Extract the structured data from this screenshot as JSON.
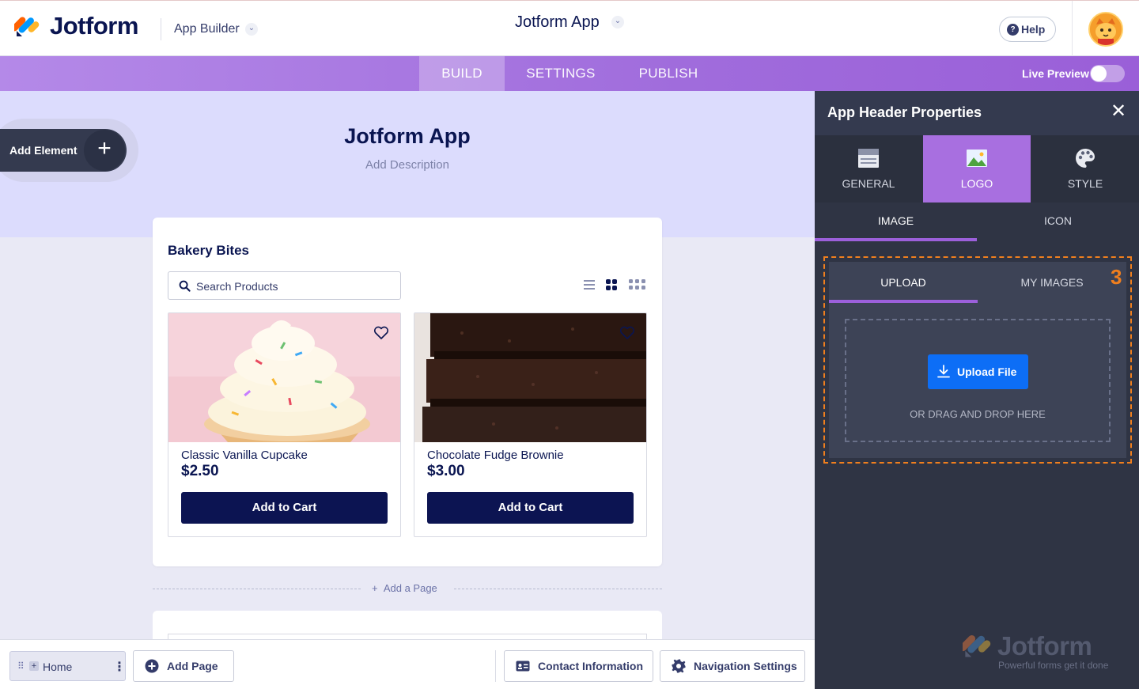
{
  "header": {
    "brand": "Jotform",
    "section": "App Builder",
    "app_title": "Jotform App",
    "help": "Help"
  },
  "tabs": {
    "build": "BUILD",
    "settings": "SETTINGS",
    "publish": "PUBLISH",
    "active": "BUILD",
    "live_preview": "Live Preview",
    "live_preview_on": false
  },
  "canvas": {
    "add_element": "Add Element",
    "title": "Jotform App",
    "description": "Add Description",
    "widget_title": "Bakery Bites",
    "search_placeholder": "Search Products",
    "products": [
      {
        "name": "Classic Vanilla Cupcake",
        "price": "$2.50",
        "button": "Add to Cart"
      },
      {
        "name": "Chocolate Fudge Brownie",
        "price": "$3.00",
        "button": "Add to Cart"
      }
    ],
    "add_page": "Add a Page"
  },
  "bottom": {
    "home": "Home",
    "add_page": "Add Page",
    "contact": "Contact Information",
    "navigation": "Navigation Settings"
  },
  "panel": {
    "title": "App Header Properties",
    "tabs": [
      "GENERAL",
      "LOGO",
      "STYLE"
    ],
    "active_tab": "LOGO",
    "subtabs": [
      "IMAGE",
      "ICON"
    ],
    "upload_tabs": [
      "UPLOAD",
      "MY IMAGES"
    ],
    "step": "3",
    "upload_button": "Upload File",
    "drag_text": "OR DRAG AND DROP HERE",
    "watermark": "Jotform",
    "watermark_tagline": "Powerful forms get it done"
  },
  "colors": {
    "primary": "#0a1551",
    "accent_purple": "#a86fe0",
    "upload_blue": "#0d6ef6",
    "highlight_orange": "#f07f1e"
  }
}
